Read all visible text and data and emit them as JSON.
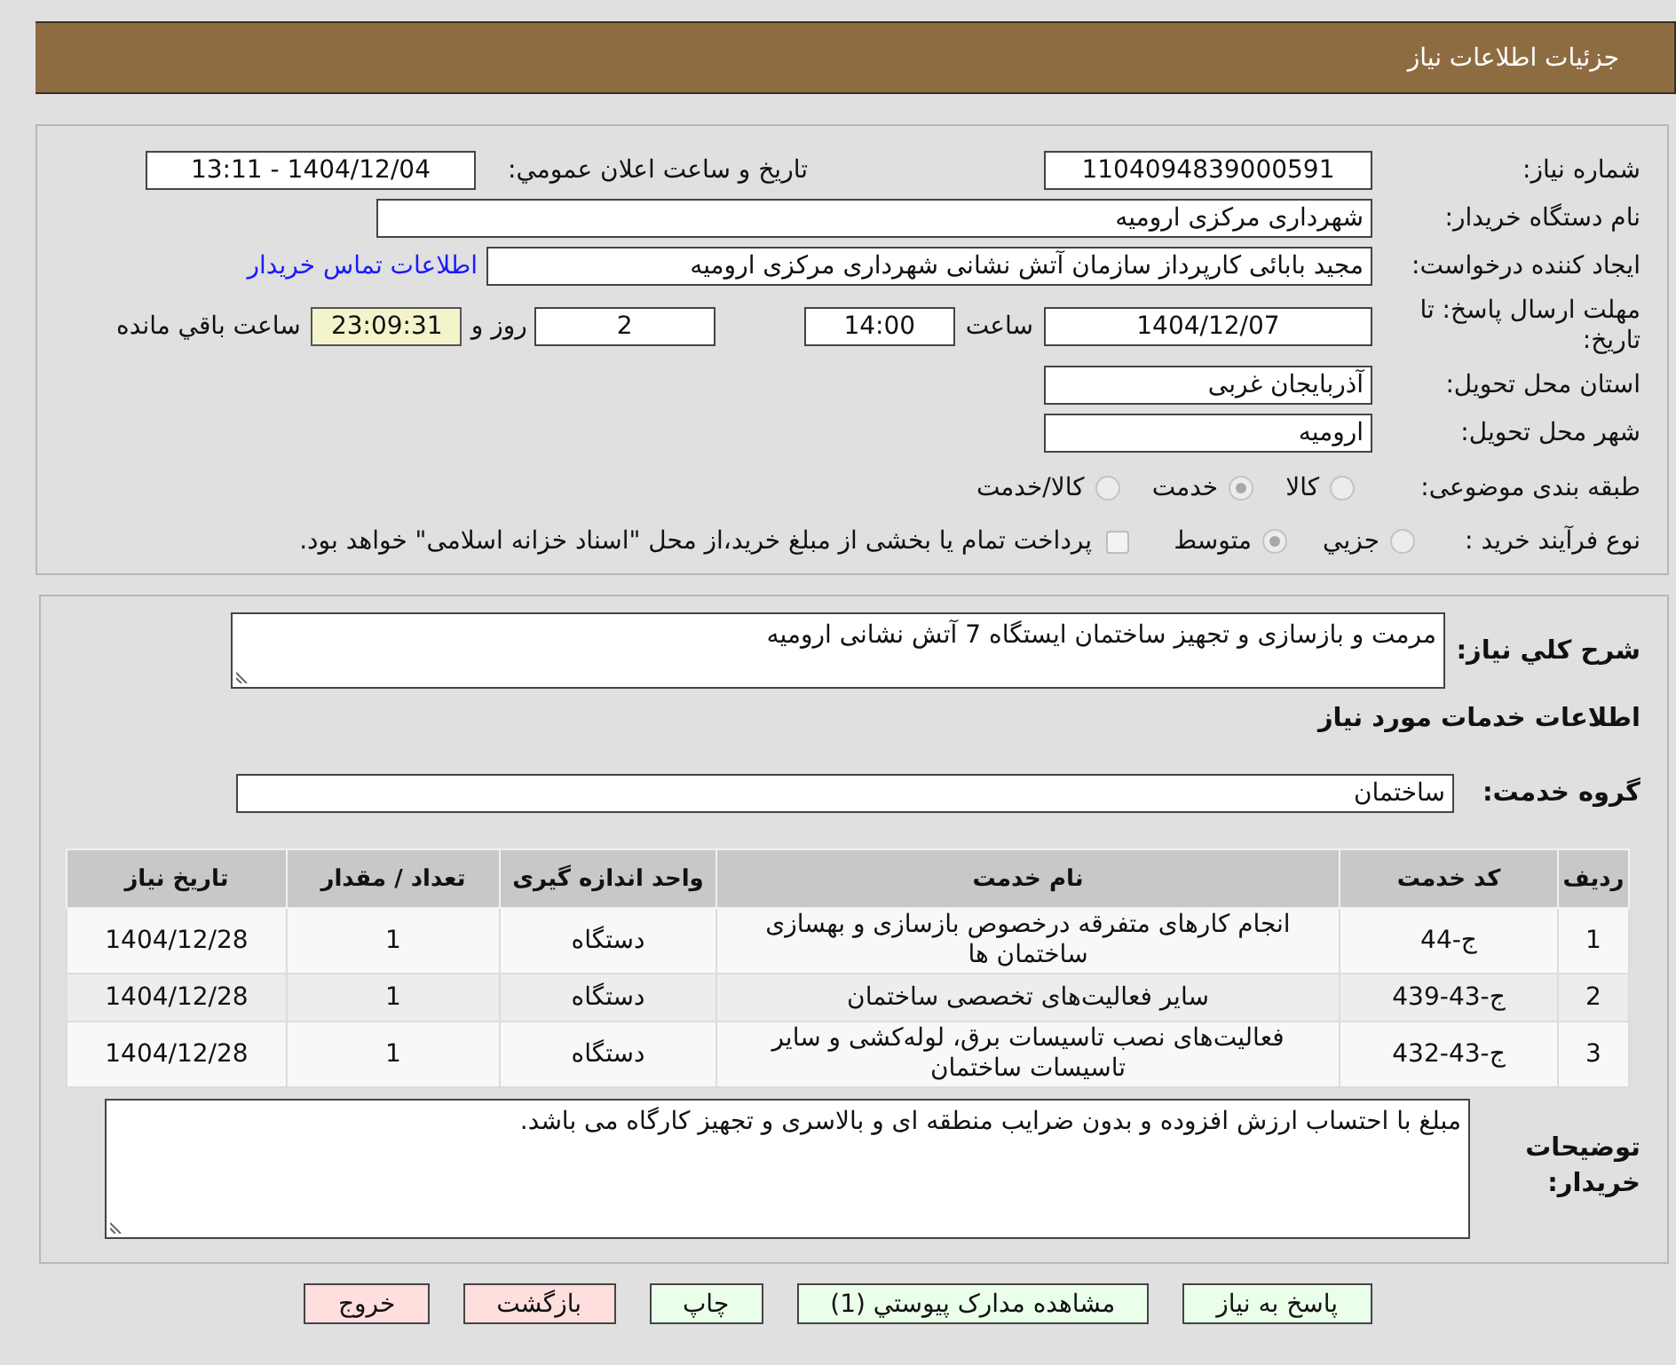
{
  "header": {
    "title": "جزئیات اطلاعات نیاز"
  },
  "details": {
    "need_number": {
      "label": "شماره نیاز:",
      "value": "1104094839000591"
    },
    "announce_datetime": {
      "label": "تاریخ و ساعت اعلان عمومي:",
      "value": "1404/12/04 - 13:11"
    },
    "buyer_org": {
      "label": "نام دستگاه خریدار:",
      "value": "شهرداری مرکزی ارومیه"
    },
    "requester": {
      "label": "ایجاد کننده درخواست:",
      "value": "مجید بابائی کارپرداز سازمان آتش نشانی شهرداری مرکزی ارومیه",
      "link": "اطلاعات تماس خریدار"
    },
    "deadline": {
      "label": "مهلت ارسال پاسخ: تا تاریخ:",
      "date": "1404/12/07",
      "time_label": "ساعت",
      "time": "14:00",
      "days": "2",
      "days_label": "روز و",
      "remaining": "23:09:31",
      "remaining_label": "ساعت باقي مانده"
    },
    "province": {
      "label": "استان محل تحویل:",
      "value": "آذربایجان غربی"
    },
    "city": {
      "label": "شهر محل تحویل:",
      "value": "ارومیه"
    },
    "category": {
      "label": "طبقه بندی موضوعی:",
      "options": [
        {
          "label": "کالا",
          "selected": false
        },
        {
          "label": "خدمت",
          "selected": true
        },
        {
          "label": "کالا/خدمت",
          "selected": false
        }
      ]
    },
    "purchase_process": {
      "label": "نوع فرآیند خرید :",
      "options": [
        {
          "label": "جزيي",
          "selected": false
        },
        {
          "label": "متوسط",
          "selected": true
        }
      ],
      "treasury": {
        "label": "پرداخت تمام یا بخشی از مبلغ خرید،از محل \"اسناد خزانه اسلامی\" خواهد بود.",
        "checked": false
      }
    }
  },
  "summary": {
    "label": "شرح کلي نیاز:",
    "value": "مرمت و بازسازی و تجهیز ساختمان ایستگاه 7 آتش نشانی ارومیه"
  },
  "services": {
    "heading": "اطلاعات خدمات مورد نیاز",
    "group": {
      "label": "گروه خدمت:",
      "value": "ساختمان"
    },
    "table": {
      "columns": [
        "ردیف",
        "کد خدمت",
        "نام خدمت",
        "واحد اندازه گیری",
        "تعداد / مقدار",
        "تاریخ نیاز"
      ],
      "rows": [
        [
          "1",
          "ج-44",
          "انجام کارهای متفرقه درخصوص بازسازی و بهسازی ساختمان ها",
          "دستگاه",
          "1",
          "1404/12/28"
        ],
        [
          "2",
          "ج-43-439",
          "سایر فعالیت‌های تخصصی ساختمان",
          "دستگاه",
          "1",
          "1404/12/28"
        ],
        [
          "3",
          "ج-43-432",
          "فعالیت‌های نصب تاسیسات برق، لوله‌کشی و سایر تاسیسات ساختمان",
          "دستگاه",
          "1",
          "1404/12/28"
        ]
      ]
    }
  },
  "buyer_notes": {
    "label": "توضیحات خریدار:",
    "value": "مبلغ با احتساب ارزش افزوده و بدون ضرایب منطقه ای و بالاسری و تجهیز کارگاه می باشد."
  },
  "buttons": [
    {
      "label": "پاسخ به نیاز",
      "kind": "action"
    },
    {
      "label": "مشاهده مدارک پیوستي (1)",
      "kind": "action"
    },
    {
      "label": "چاپ",
      "kind": "action"
    },
    {
      "label": "بازگشت",
      "kind": "exit"
    },
    {
      "label": "خروج",
      "kind": "exit"
    }
  ]
}
